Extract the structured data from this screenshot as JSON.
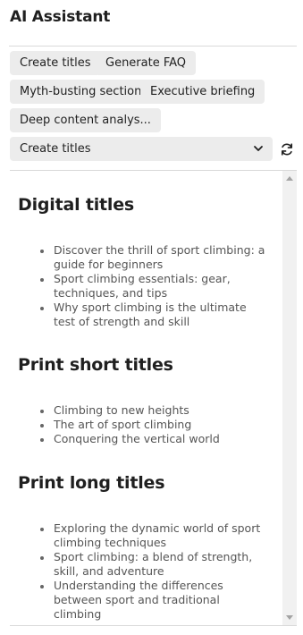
{
  "app": {
    "title": "AI Assistant"
  },
  "actions": [
    {
      "label": "Create titles"
    },
    {
      "label": "Generate FAQ"
    },
    {
      "label": "Myth-busting section"
    },
    {
      "label": "Executive briefing"
    },
    {
      "label": "Deep content analys..."
    }
  ],
  "mode_select": {
    "selected": "Create titles"
  },
  "sections": [
    {
      "heading": "Digital titles",
      "items": [
        "Discover the thrill of sport climbing: a guide for beginners",
        "Sport climbing essentials: gear, techniques, and tips",
        "Why sport climbing is the ultimate test of strength and skill"
      ]
    },
    {
      "heading": "Print short titles",
      "items": [
        "Climbing to new heights",
        "The art of sport climbing",
        "Conquering the vertical world"
      ]
    },
    {
      "heading": "Print long titles",
      "items": [
        "Exploring the dynamic world of sport climbing techniques",
        "Sport climbing: a blend of strength, skill, and adventure",
        "Understanding the differences between sport and traditional climbing"
      ]
    }
  ]
}
